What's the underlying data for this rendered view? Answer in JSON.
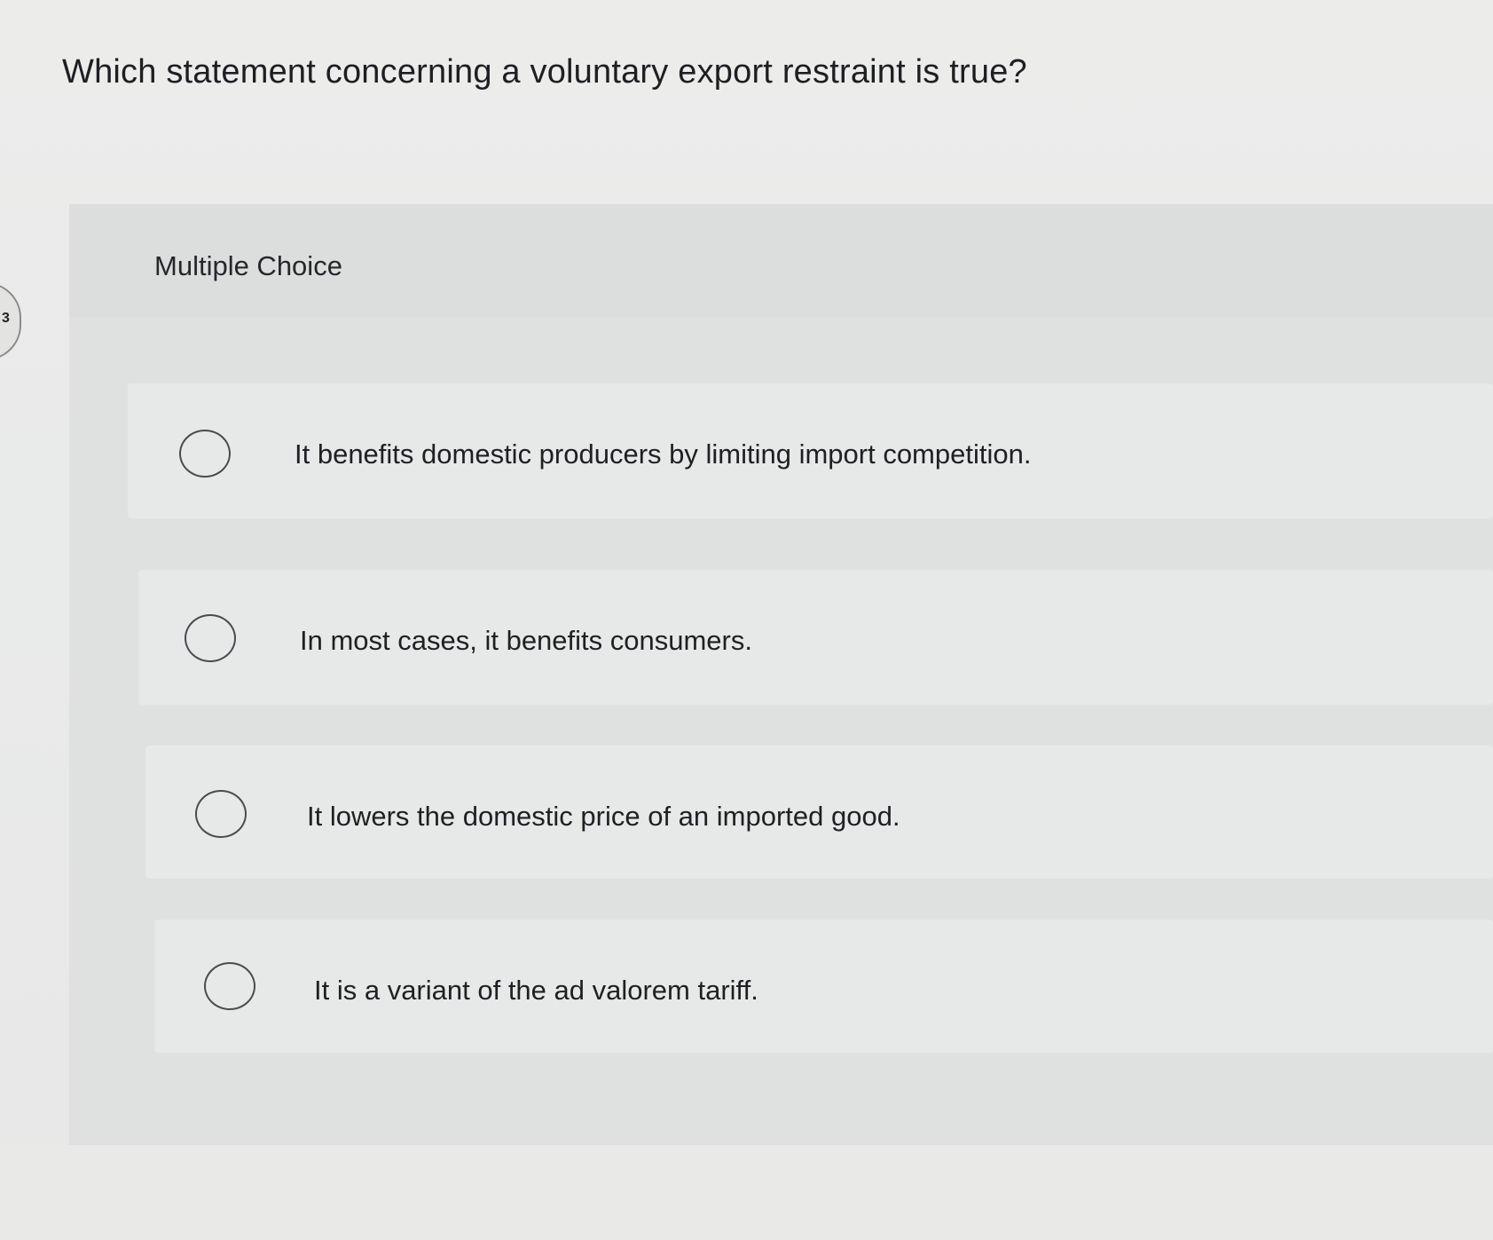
{
  "question": {
    "text": "Which statement concerning a voluntary export restraint is true?"
  },
  "section": {
    "label": "Multiple Choice"
  },
  "options": [
    {
      "text": "It benefits domestic producers by limiting import competition.",
      "selected": false
    },
    {
      "text": "In most cases, it benefits consumers.",
      "selected": false
    },
    {
      "text": "It lowers the domestic price of an imported good.",
      "selected": false
    },
    {
      "text": "It is a variant of the ad valorem tariff.",
      "selected": false
    }
  ],
  "edge_tab": {
    "glyph": "3"
  }
}
